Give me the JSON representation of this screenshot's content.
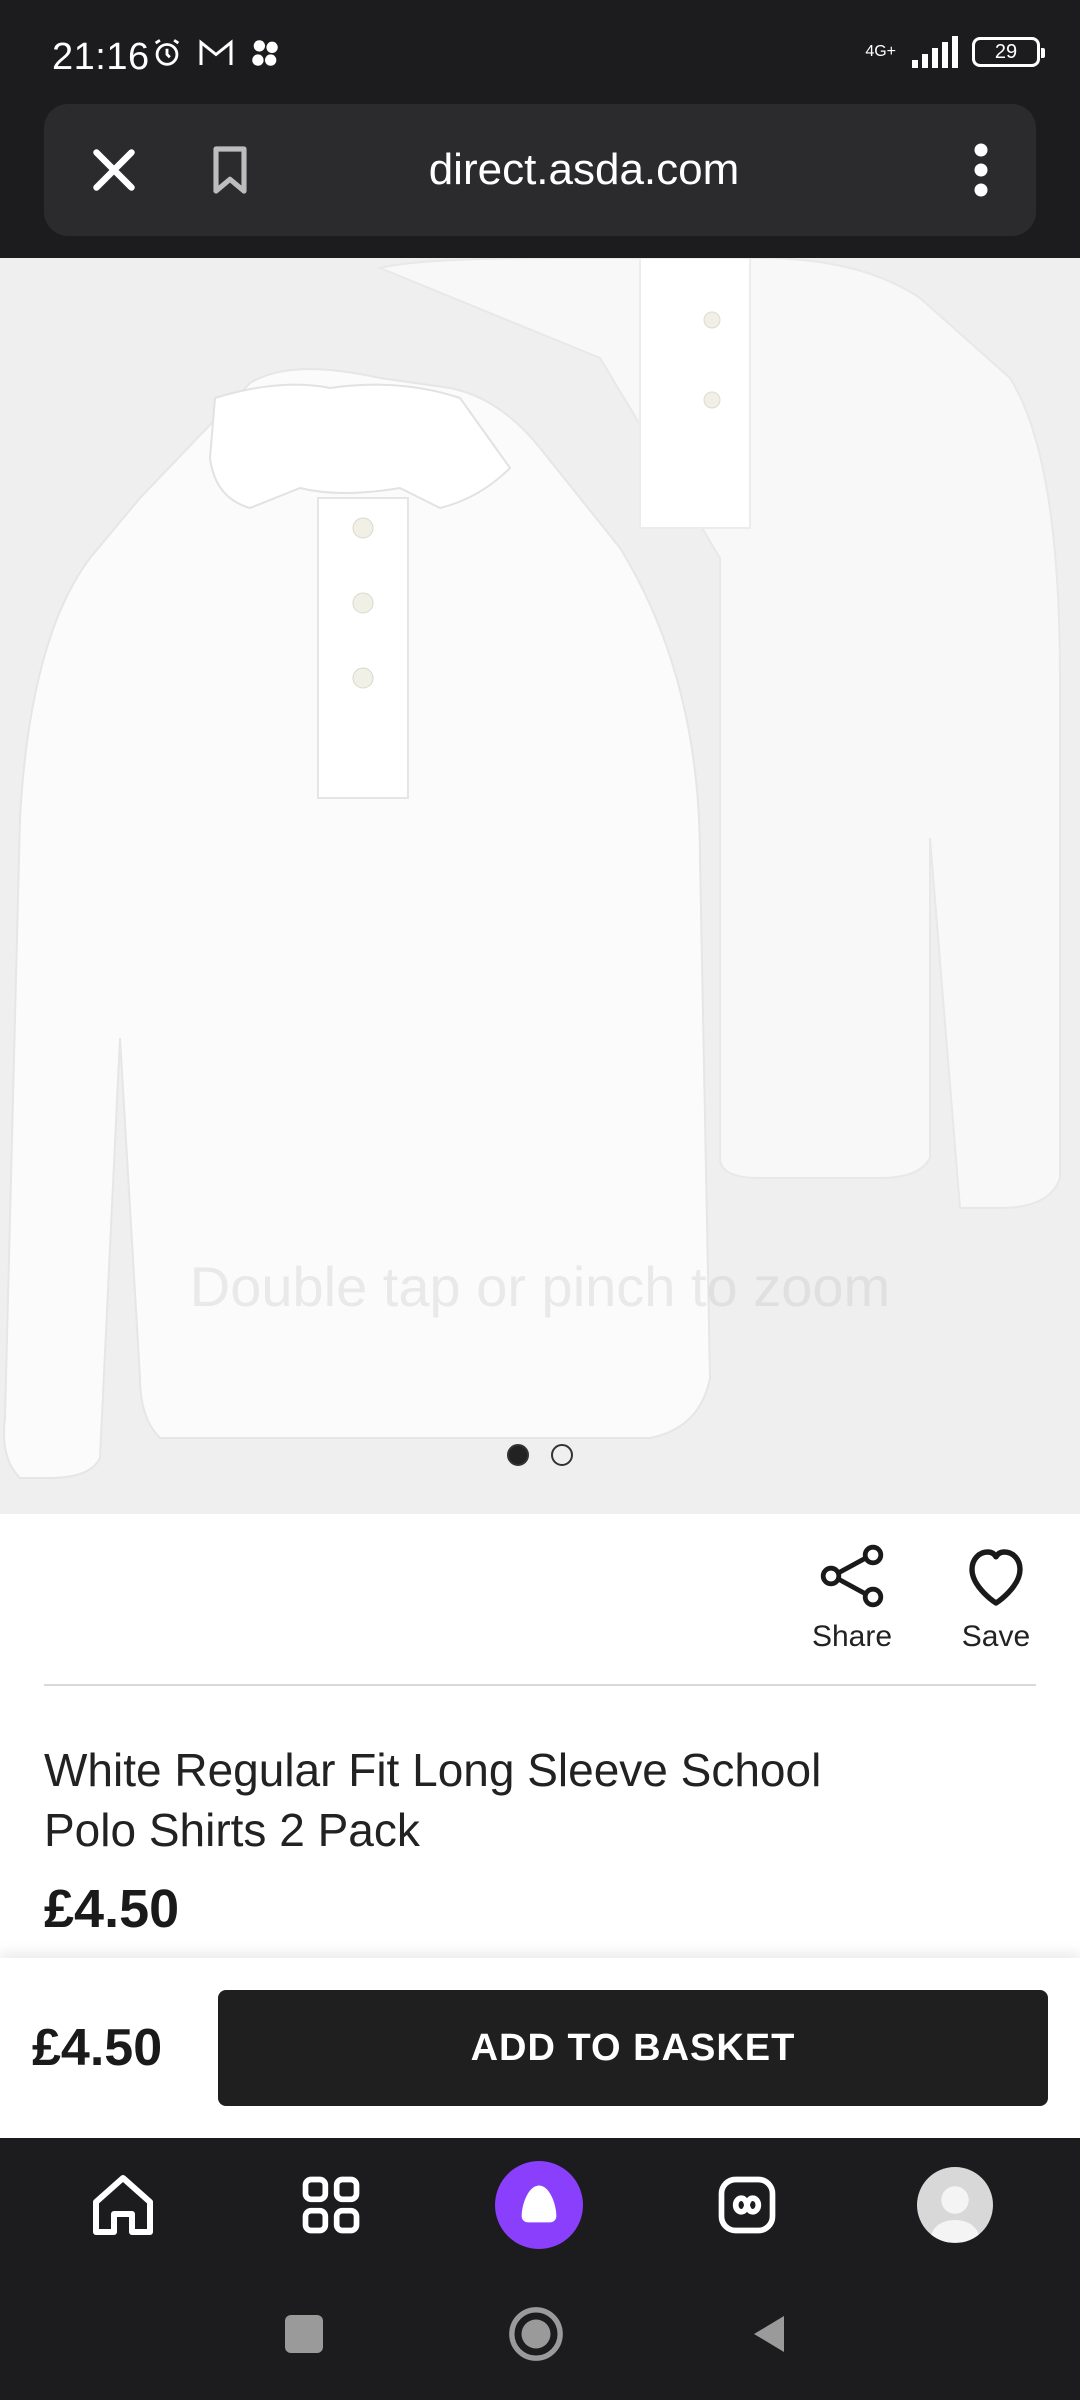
{
  "status_bar": {
    "time": "21:16",
    "network": "4G+",
    "battery": "29",
    "left_icons": [
      "alarm-icon",
      "gmail-icon",
      "app-cluster-icon"
    ]
  },
  "browser": {
    "url": "direct.asda.com",
    "icons": [
      "close-icon",
      "bookmark-icon",
      "more-vert-icon"
    ]
  },
  "product": {
    "zoom_hint": "Double tap or pinch to zoom",
    "image_count": 2,
    "active_image": 1,
    "share_label": "Share",
    "save_label": "Save",
    "title": "White Regular Fit Long Sleeve School Polo Shirts 2 Pack",
    "price": "£4.50"
  },
  "sticky": {
    "price": "£4.50",
    "add_to_basket": "ADD TO BASKET"
  },
  "bottom_nav": {
    "items": [
      "home-icon",
      "apps-icon",
      "alice-assistant-icon",
      "tabs-icon",
      "profile-avatar"
    ],
    "accent": "#8a3ffc"
  },
  "system_nav": {
    "items": [
      "recents-button",
      "home-button",
      "back-button"
    ]
  }
}
